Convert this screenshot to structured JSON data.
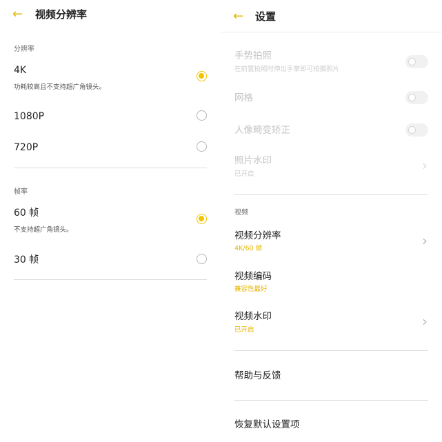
{
  "left": {
    "back_icon": "←",
    "title": "视频分辨率",
    "resolution": {
      "section_label": "分辨率",
      "options": [
        {
          "label": "4K",
          "note": "功耗较高且不支持超广角镜头。",
          "selected": true
        },
        {
          "label": "1080P",
          "selected": false
        },
        {
          "label": "720P",
          "selected": false
        }
      ]
    },
    "framerate": {
      "section_label": "帧率",
      "options": [
        {
          "label": "60 帧",
          "note": "不支持超广角镜头。",
          "selected": true
        },
        {
          "label": "30 帧",
          "selected": false
        }
      ]
    }
  },
  "right": {
    "back_icon": "←",
    "title": "设置",
    "items": [
      {
        "title": "手势拍照",
        "subtitle": "在前置拍照时伸出手掌即可拍摄照片",
        "control": "toggle",
        "disabled": true
      },
      {
        "title": "网格",
        "control": "toggle",
        "disabled": true
      },
      {
        "title": "人像畸变矫正",
        "control": "toggle",
        "disabled": true
      },
      {
        "title": "照片水印",
        "subtitle": "已开启",
        "control": "chevron",
        "disabled": true
      }
    ],
    "video_section": "视频",
    "video_items": [
      {
        "title": "视频分辨率",
        "subtitle": "4K/60 帧",
        "control": "chevron"
      },
      {
        "title": "视频编码",
        "subtitle": "兼容性最好",
        "control": "none"
      },
      {
        "title": "视频水印",
        "subtitle": "已开启",
        "control": "chevron"
      }
    ],
    "help_feedback": "帮助与反馈",
    "reset_defaults": "恢复默认设置项",
    "chevron_icon": "›"
  },
  "colors": {
    "accent": "#f0c400",
    "accent_text": "#e6b400",
    "disabled_text": "#c4c4c4",
    "divider": "#dcdcdc"
  }
}
